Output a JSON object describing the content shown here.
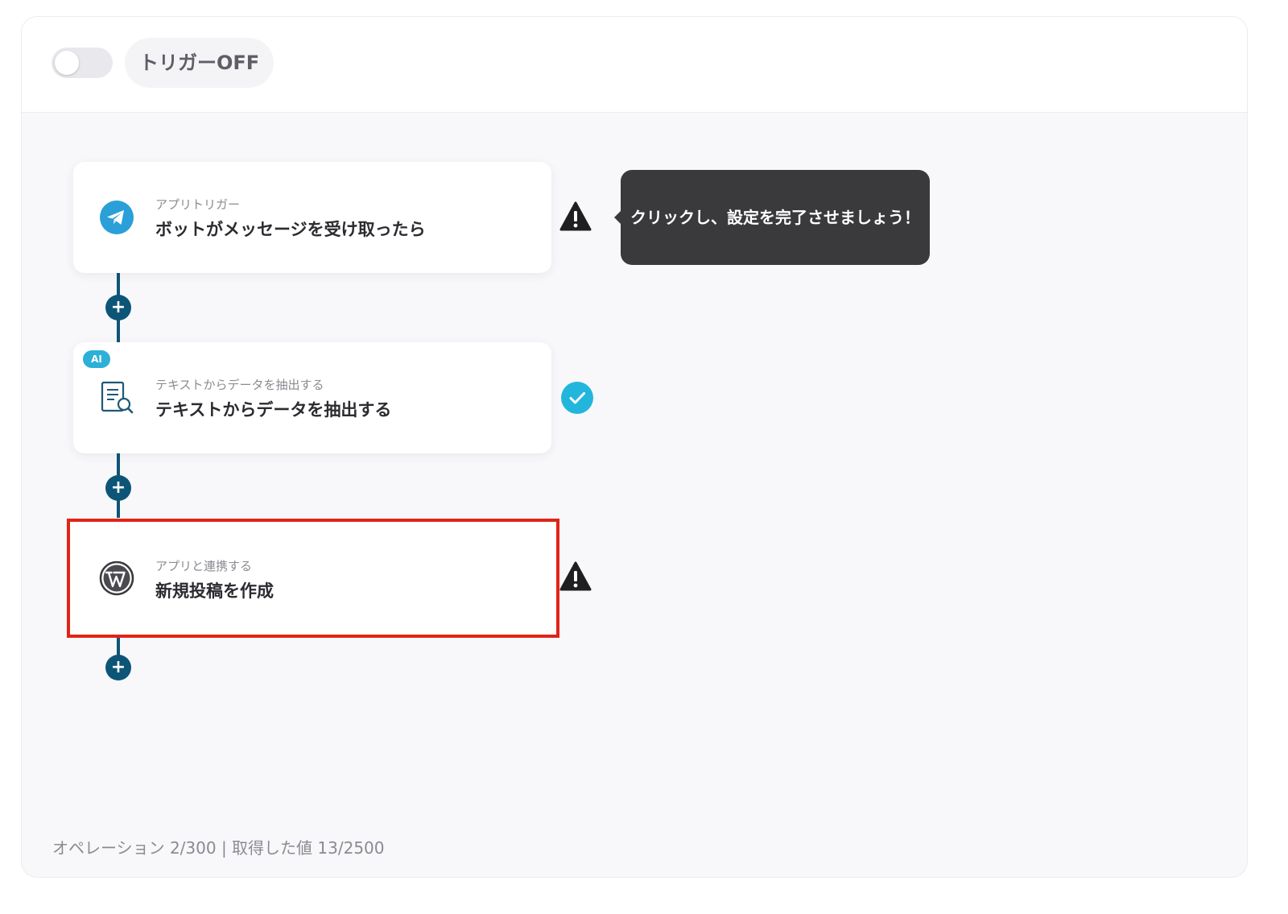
{
  "header": {
    "trigger_toggle_state": "off",
    "trigger_label": "トリガーOFF"
  },
  "steps": [
    {
      "type_label": "アプリトリガー",
      "title": "ボットがメッセージを受け取ったら",
      "icon": "telegram-icon",
      "status": "warning",
      "ai_badge": ""
    },
    {
      "type_label": "テキストからデータを抽出する",
      "title": "テキストからデータを抽出する",
      "icon": "document-search-icon",
      "status": "complete",
      "ai_badge": "AI"
    },
    {
      "type_label": "アプリと連携する",
      "title": "新規投稿を作成",
      "icon": "wordpress-icon",
      "status": "warning",
      "ai_badge": ""
    }
  ],
  "tooltip": {
    "text": "クリックし、設定を完了させましょう！"
  },
  "footer": {
    "usage": "オペレーション 2/300 | 取得した値 13/2500"
  },
  "colors": {
    "connector": "#0d5577",
    "highlight_border": "#e02418",
    "check": "#23b6dd",
    "telegram": "#2a9fd8",
    "tooltip_bg": "#3a3a3d"
  }
}
